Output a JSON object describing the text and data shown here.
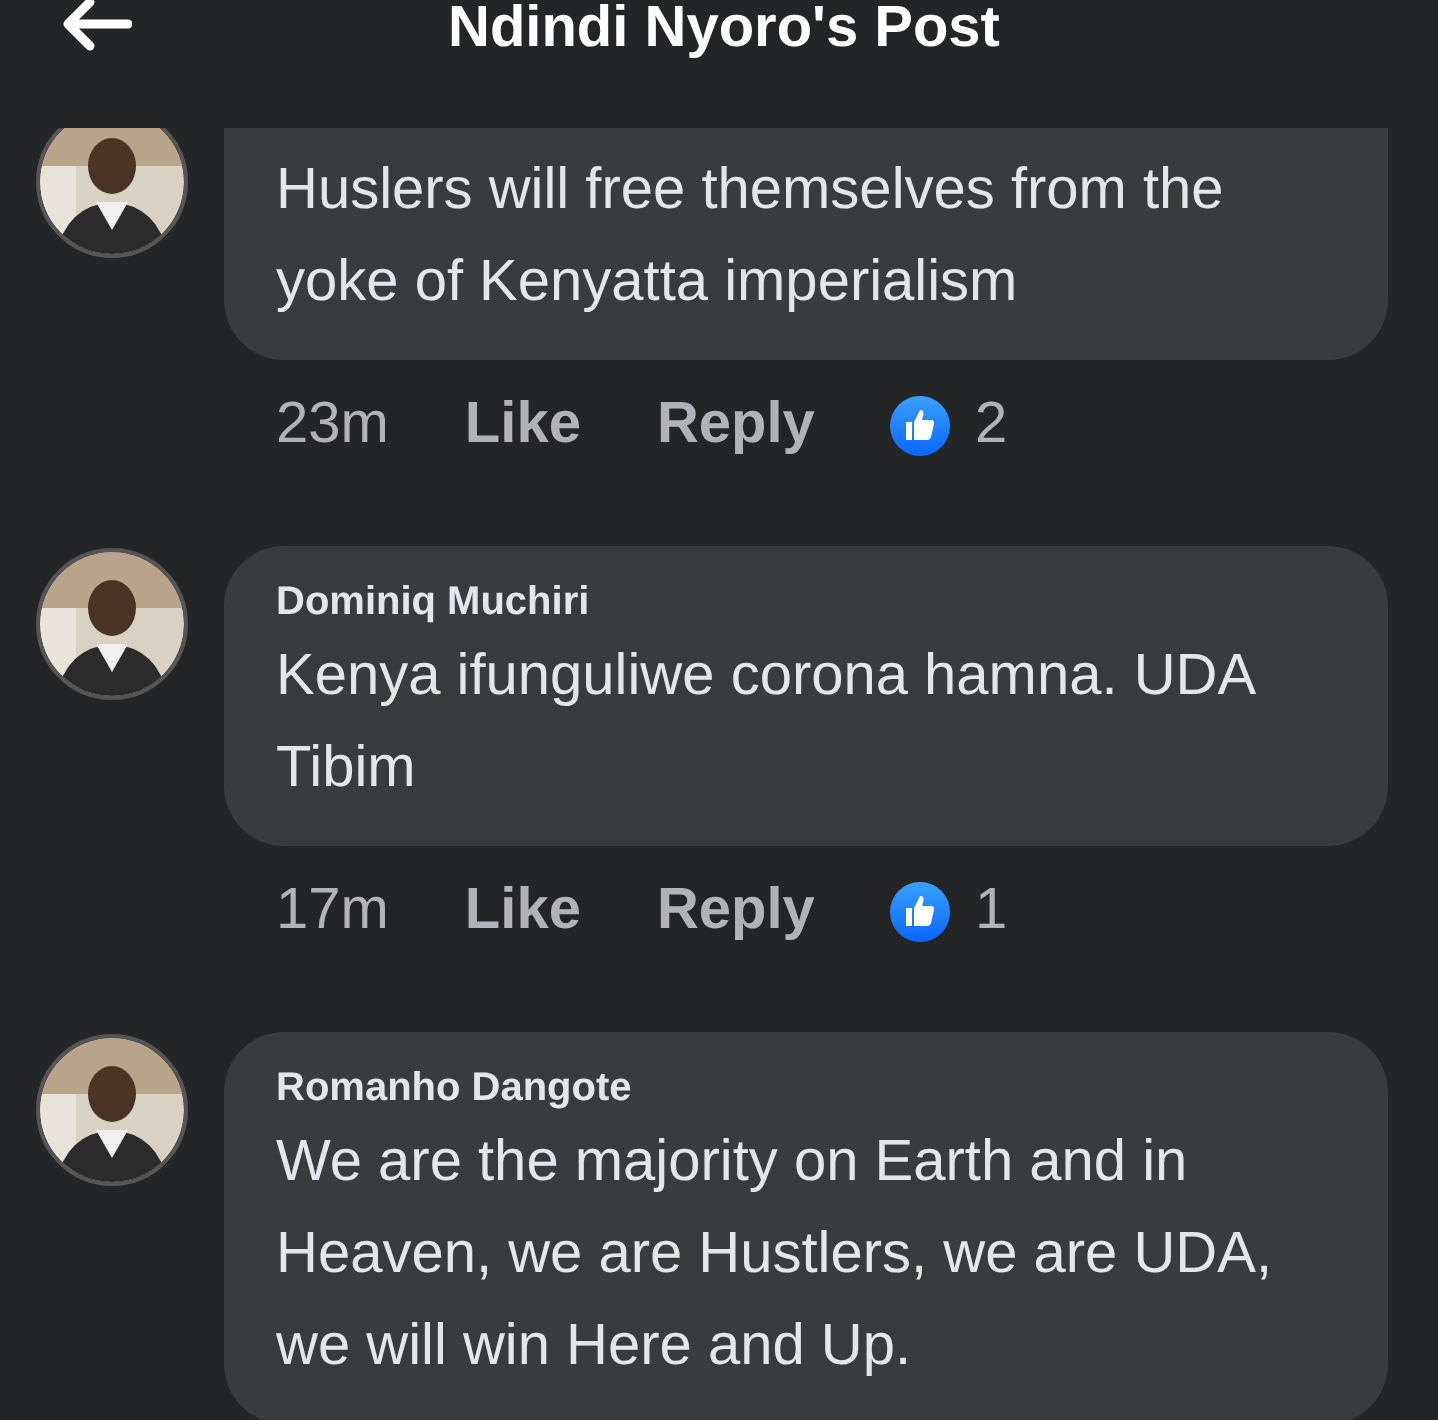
{
  "header": {
    "title": "Ndindi Nyoro's Post"
  },
  "comments": [
    {
      "text": "Huslers will free themselves from the yoke of Kenyatta imperialism",
      "time": "23m",
      "like": "Like",
      "reply": "Reply",
      "reactions": "2"
    },
    {
      "author": "Dominiq Muchiri",
      "text": "Kenya ifunguliwe corona hamna. UDA Tibim",
      "time": "17m",
      "like": "Like",
      "reply": "Reply",
      "reactions": "1"
    },
    {
      "author": "Romanho Dangote",
      "text": "We are the majority on Earth and in Heaven, we are Hustlers, we are UDA, we will win Here and Up."
    }
  ]
}
